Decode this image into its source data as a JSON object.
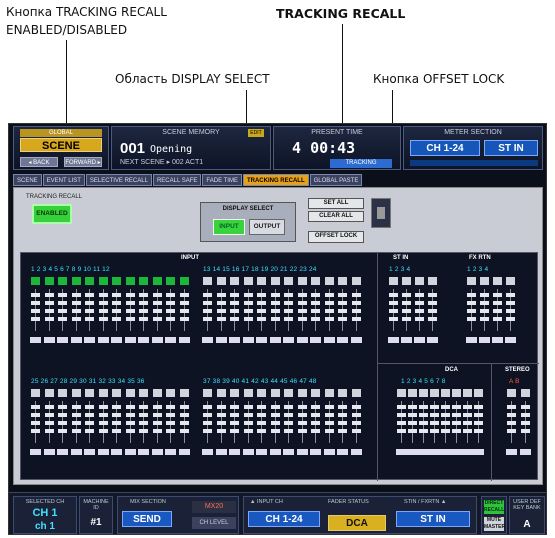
{
  "callouts": {
    "tracking_recall_btn_line1": "Кнопка TRACKING RECALL",
    "tracking_recall_btn_line2": "ENABLED/DISABLED",
    "tracking_recall_title": "TRACKING RECALL",
    "display_select_area": "Область DISPLAY SELECT",
    "offset_lock_btn": "Кнопка OFFSET LOCK"
  },
  "header": {
    "scene_tag": "GLOBAL",
    "scene_label": "SCENE",
    "back_label": "◂ BACK",
    "forward_label": "FORWARD ▸",
    "scene_memory_title": "SCENE MEMORY",
    "edit_badge": "EDIT",
    "scene_number": "001",
    "scene_name": "Opening",
    "next_label": "NEXT SCENE",
    "next_scene": "▸ 002 ACT1",
    "present_time_title": "PRESENT TIME",
    "present_time_hour": "4",
    "present_time_value": "00:43",
    "tracking_badge": "TRACKING",
    "meter_title": "METER SECTION",
    "meter_ch": "CH 1-24",
    "meter_st": "ST IN"
  },
  "tabs": [
    {
      "label": "SCENE"
    },
    {
      "label": "EVENT LIST"
    },
    {
      "label": "SELECTIVE RECALL"
    },
    {
      "label": "RECALL SAFE"
    },
    {
      "label": "FADE TIME"
    },
    {
      "label": "TRACKING RECALL"
    },
    {
      "label": "GLOBAL PASTE"
    }
  ],
  "panel": {
    "tracking_recall_label": "TRACKING RECALL",
    "enabled_label": "ENABLED",
    "display_select_title": "DISPLAY SELECT",
    "input_label": "INPUT",
    "output_label": "OUTPUT",
    "set_all": "SET ALL",
    "clear_all": "CLEAR ALL",
    "offset_lock": "OFFSET LOCK"
  },
  "channels": {
    "input_title": "INPUT",
    "st_in_title": "ST IN",
    "fx_rtn_title": "FX RTN",
    "dca_title": "DCA",
    "stereo_title": "STEREO",
    "row1_left": "1  2  3  4  5  6  7  8  9 10 11 12",
    "row1_right": "13 14 15 16 17 18 19 20 21 22 23 24",
    "row2_left": "25 26 27 28 29 30 31 32 33 34 35 36",
    "row2_right": "37 38 39 40 41 42 43 44 45 46 47 48",
    "st_in_nums": "1  2  3  4",
    "fx_rtn_nums": "1  2  3  4",
    "dca_nums": "1  2  3  4  5  6  7  8",
    "stereo_nums": "A  B"
  },
  "bottom": {
    "selected_ch_title": "SELECTED CH",
    "selected_ch": "CH 1",
    "selected_ch_sub": "ch 1",
    "machine_id_title": "MACHINE ID",
    "machine_id": "#1",
    "mix_section_title": "MIX SECTION",
    "send_label": "SEND",
    "mix_name": "MX20",
    "ch_level": "CH LEVEL",
    "input_ch_title": "▲ INPUT CH",
    "input_ch": "CH 1-24",
    "fader_status_title": "FADER STATUS",
    "fader_status": "DCA",
    "stin_fxrtn_title": "STIN / FXRTN ▲",
    "stin_fxrtn": "ST IN",
    "direct_recall": "DIRECT RECALL",
    "mute_master": "MUTE MASTER",
    "user_def_title": "USER DEF KEY BANK",
    "user_def_value": "A"
  },
  "colors": {
    "accent_orange": "#e8a018",
    "enabled_green": "#37d03b",
    "meter_blue": "#1858c0",
    "channel_cyan": "#3fe0ff"
  }
}
